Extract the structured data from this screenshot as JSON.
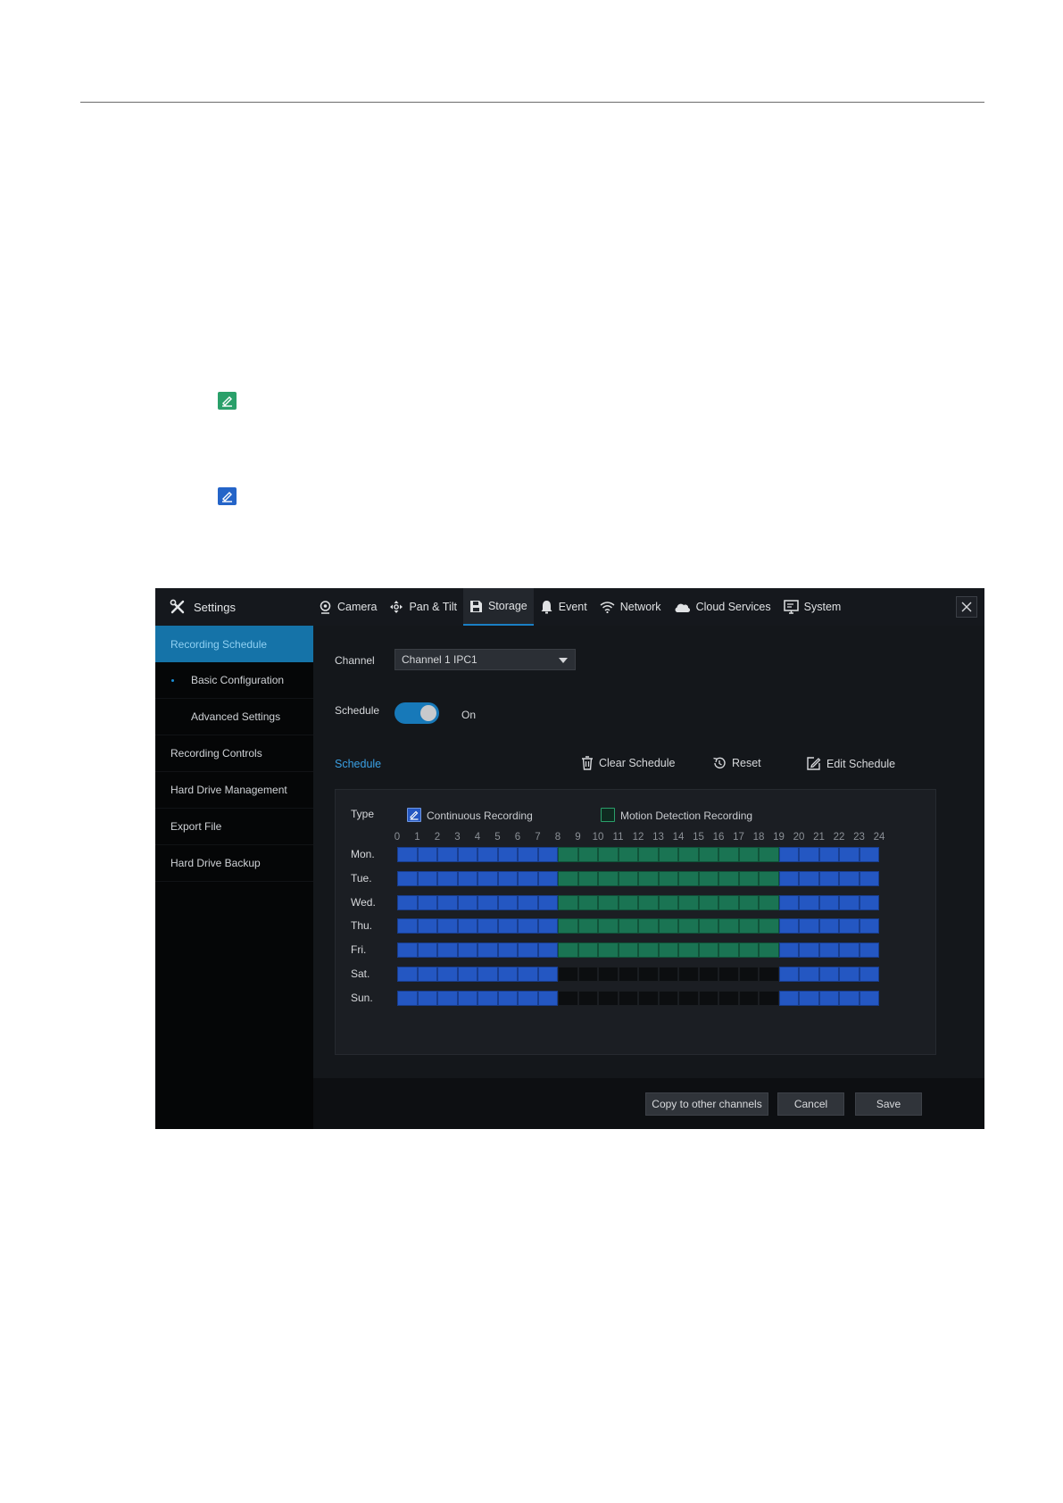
{
  "window": {
    "title": "Settings",
    "tabs": [
      {
        "label": "Camera",
        "icon": "camera-icon"
      },
      {
        "label": "Pan & Tilt",
        "icon": "pan-tilt-icon"
      },
      {
        "label": "Storage",
        "icon": "storage-icon",
        "active": true
      },
      {
        "label": "Event",
        "icon": "bell-icon"
      },
      {
        "label": "Network",
        "icon": "wifi-icon"
      },
      {
        "label": "Cloud Services",
        "icon": "cloud-icon"
      },
      {
        "label": "System",
        "icon": "monitor-icon"
      }
    ]
  },
  "sidebar": {
    "items": [
      {
        "label": "Recording Schedule",
        "active": true
      },
      {
        "label": "Basic Configuration",
        "sub": true,
        "selected": true
      },
      {
        "label": "Advanced Settings",
        "sub": true
      },
      {
        "label": "Recording Controls"
      },
      {
        "label": "Hard Drive Management"
      },
      {
        "label": "Export File"
      },
      {
        "label": "Hard Drive Backup"
      }
    ]
  },
  "form": {
    "channel_label": "Channel",
    "channel_value": "Channel 1 IPC1",
    "schedule_label": "Schedule",
    "schedule_state": "On",
    "schedule_enabled": true
  },
  "schedule": {
    "section_title": "Schedule",
    "actions": {
      "clear": "Clear Schedule",
      "reset": "Reset",
      "edit": "Edit Schedule"
    },
    "type_label": "Type",
    "types": {
      "continuous": "Continuous Recording",
      "motion": "Motion Detection Recording"
    },
    "hours": [
      "0",
      "1",
      "2",
      "3",
      "4",
      "5",
      "6",
      "7",
      "8",
      "9",
      "10",
      "11",
      "12",
      "13",
      "14",
      "15",
      "16",
      "17",
      "18",
      "19",
      "20",
      "21",
      "22",
      "23",
      "24"
    ],
    "days": [
      {
        "label": "Mon.",
        "slots": "CCCCCCCCMMMMMMMMMMMCCCCC"
      },
      {
        "label": "Tue.",
        "slots": "CCCCCCCCMMMMMMMMMMMCCCCC"
      },
      {
        "label": "Wed.",
        "slots": "CCCCCCCCMMMMMMMMMMMCCCCC"
      },
      {
        "label": "Thu.",
        "slots": "CCCCCCCCMMMMMMMMMMMCCCCC"
      },
      {
        "label": "Fri.",
        "slots": "CCCCCCCCMMMMMMMMMMMCCCCC"
      },
      {
        "label": "Sat.",
        "slots": "CCCCCCCC-----------CCCCC"
      },
      {
        "label": "Sun.",
        "slots": "CCCCCCCC-----------CCCCC"
      }
    ],
    "colors": {
      "continuous": "#2457c2",
      "motion": "#1a7453",
      "empty": "#0c0e10"
    }
  },
  "footer": {
    "copy": "Copy to other channels",
    "cancel": "Cancel",
    "save": "Save"
  },
  "legend_icons": {
    "green": "edit-schedule-green-icon",
    "blue": "edit-schedule-blue-icon"
  }
}
